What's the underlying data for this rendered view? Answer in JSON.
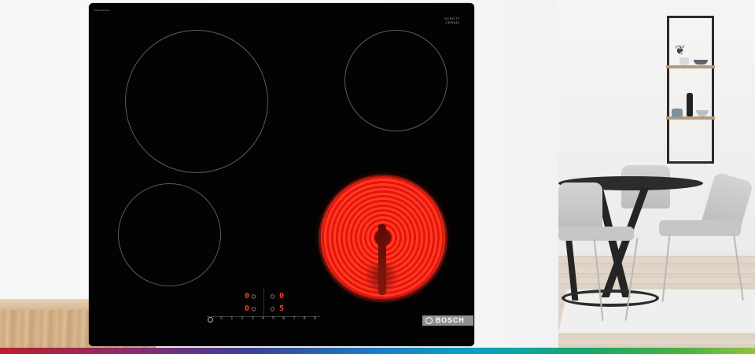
{
  "hob": {
    "model_code": "PKE611BA2E",
    "brand_label": "BOSCH",
    "edge_mark_line1": "SCHOTT",
    "edge_mark_line2": "CERAN",
    "edge_mark_line3": "",
    "zone_left_digit_top": "0",
    "zone_right_digit_top": "0",
    "zone_right_digit_bottom": "5",
    "zone_left_digit_bottom": "0",
    "power_symbol": "⏻",
    "slider_scale": [
      "0",
      "1",
      "2",
      "3",
      "4",
      "5",
      "6",
      "7",
      "8",
      "9"
    ],
    "hot_zone": "rear-right glowing red"
  },
  "colors": {
    "hob_glass": "#030303",
    "heat_red": "#e3150d",
    "digit_red": "#ff3b2e",
    "logo_plate": "#8f8f8f"
  },
  "scene": {
    "left": "wooden countertop edge",
    "right": "dining room with round black table, grey chairs and wall shelf"
  }
}
